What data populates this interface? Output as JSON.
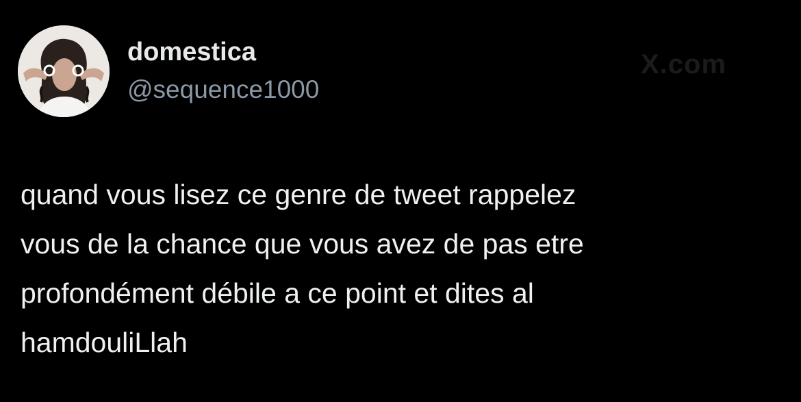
{
  "tweet": {
    "author": {
      "display_name": "domestica",
      "handle": "@sequence1000",
      "avatar": "profile-photo"
    },
    "watermark": "X.com",
    "text": "quand vous lisez ce genre de tweet rappelez\nvous de la chance que vous avez de pas etre\nprofondément débile a ce point et dites al\nhamdouliLlah"
  },
  "colors": {
    "background": "#000000",
    "text": "#e7e9ea",
    "handle": "#8b98a5"
  }
}
